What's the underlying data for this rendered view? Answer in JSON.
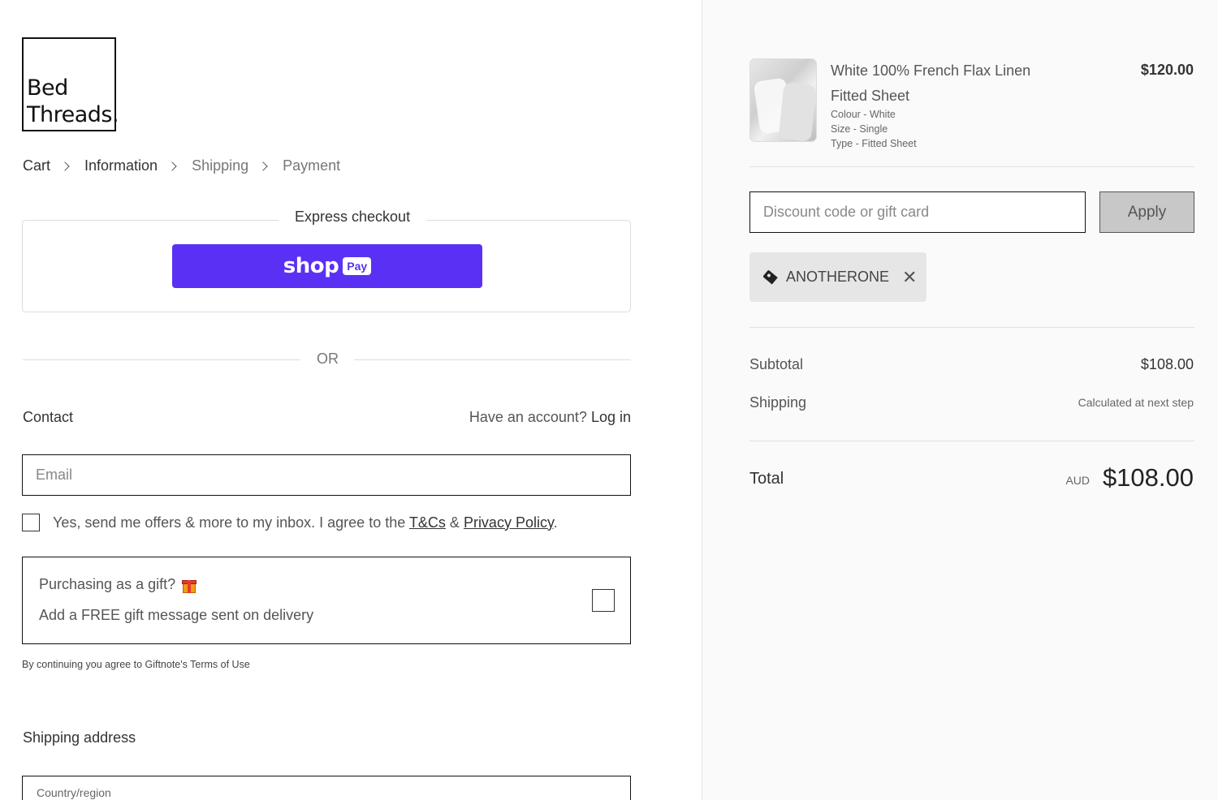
{
  "logo": {
    "line1": "Bed",
    "line2": "Threads."
  },
  "breadcrumb": [
    {
      "label": "Cart"
    },
    {
      "label": "Information"
    },
    {
      "label": "Shipping"
    },
    {
      "label": "Payment"
    }
  ],
  "express": {
    "title": "Express checkout",
    "shop_word": "shop",
    "shop_pay": "Pay",
    "brand_color": "#5a31f4"
  },
  "divider_or": "OR",
  "contact": {
    "label": "Contact",
    "account_prompt": "Have an account?",
    "login_label": "Log in",
    "email_placeholder": "Email",
    "consent_text": "Yes, send me offers & more to my inbox. I agree to the ",
    "tcs_label": "T&Cs",
    "amp": " & ",
    "privacy_label": "Privacy Policy",
    "period": "."
  },
  "gift": {
    "question": "Purchasing as a gift?",
    "subtitle": "Add a FREE gift message sent on delivery",
    "icon": "gift-icon",
    "terms": "By continuing you agree to Giftnote's Terms of Use"
  },
  "shipping": {
    "label": "Shipping address",
    "country_label": "Country/region"
  },
  "order": {
    "product": {
      "name": "White 100% French Flax Linen Fitted Sheet",
      "colour": "Colour - White",
      "size": "Size - Single",
      "type": "Type - Fitted Sheet",
      "price": "$120.00"
    },
    "discount_placeholder": "Discount code or gift card",
    "apply_label": "Apply",
    "applied_code": "ANOTHERONE",
    "subtotal_label": "Subtotal",
    "subtotal_value": "$108.00",
    "shipping_label": "Shipping",
    "shipping_value": "Calculated at next step",
    "total_label": "Total",
    "currency": "AUD",
    "total_value": "$108.00"
  }
}
